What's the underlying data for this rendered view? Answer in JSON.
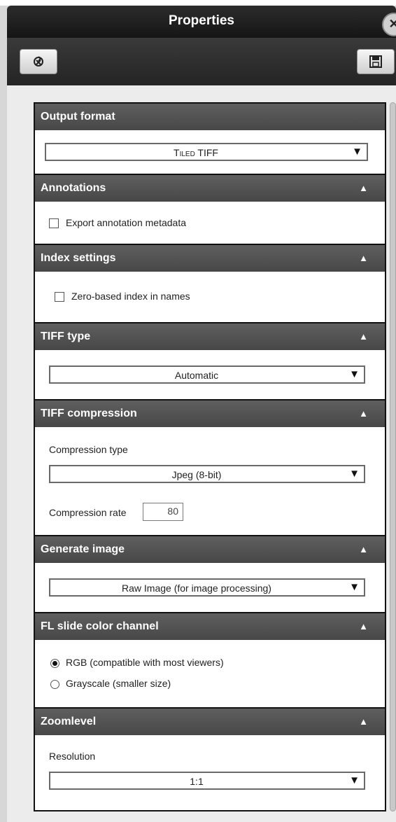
{
  "window": {
    "title": "Properties"
  },
  "toolbar": {
    "reset_icon": "reset-icon",
    "save_icon": "save-icon"
  },
  "sections": {
    "output_format": {
      "header": "Output format",
      "value": "Tiled TIFF"
    },
    "annotations": {
      "header": "Annotations",
      "checkbox_label": "Export annotation metadata",
      "checked": false
    },
    "index_settings": {
      "header": "Index settings",
      "checkbox_label": "Zero-based index in names",
      "checked": false
    },
    "tiff_type": {
      "header": "TIFF type",
      "value": "Automatic"
    },
    "tiff_compression": {
      "header": "TIFF compression",
      "type_label": "Compression type",
      "type_value": "Jpeg (8-bit)",
      "rate_label": "Compression rate",
      "rate_value": "80"
    },
    "generate_image": {
      "header": "Generate image",
      "value": "Raw Image (for image processing)"
    },
    "fl_color_channel": {
      "header": "FL slide color channel",
      "options": [
        "RGB (compatible with most viewers)",
        "Grayscale (smaller size)"
      ],
      "selected": "RGB (compatible with most viewers)"
    },
    "zoomlevel": {
      "header": "Zoomlevel",
      "resolution_label": "Resolution",
      "value": "1:1"
    }
  },
  "icons": {
    "collapse": "▲",
    "dropdown": "▼",
    "close": "✕"
  }
}
